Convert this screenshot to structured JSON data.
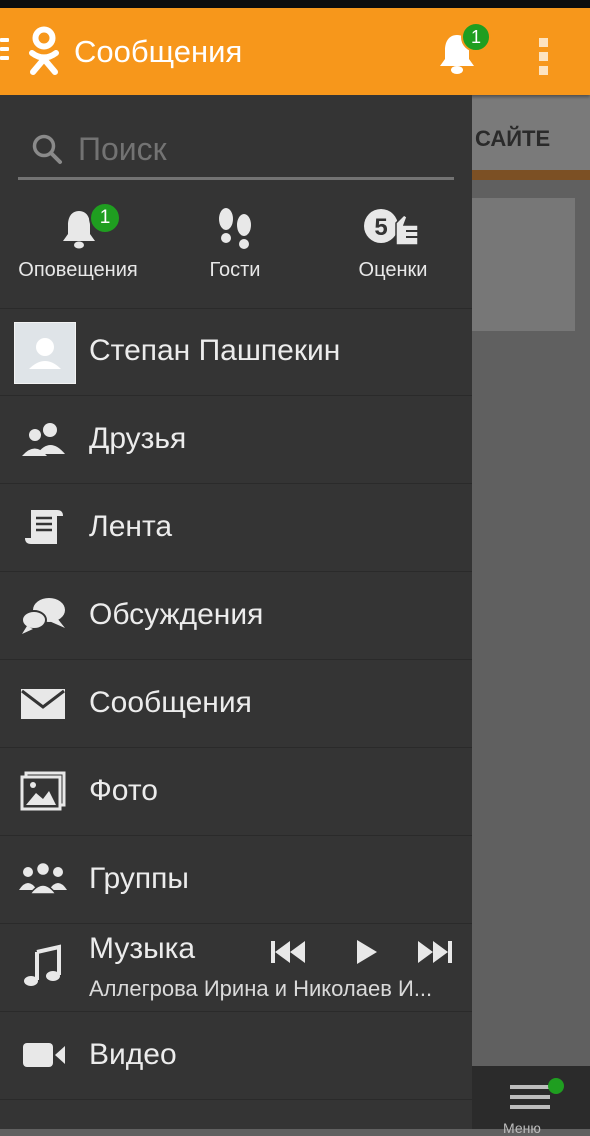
{
  "app_bar": {
    "title": "Сообщения",
    "notification_count": "1",
    "colors": {
      "bar": "#f7971b",
      "badge": "#1f9e20"
    }
  },
  "background": {
    "tab_label": "САЙТЕ",
    "bottom_nav_label": "Меню"
  },
  "drawer": {
    "search": {
      "placeholder": "Поиск"
    },
    "quick_actions": [
      {
        "label": "Оповещения",
        "icon": "bell-icon",
        "badge": "1"
      },
      {
        "label": "Гости",
        "icon": "footprints-icon"
      },
      {
        "label": "Оценки",
        "icon": "rating-five-icon"
      }
    ],
    "profile": {
      "name": "Степан Пашпекин"
    },
    "menu": [
      {
        "label": "Друзья",
        "icon": "friends-icon"
      },
      {
        "label": "Лента",
        "icon": "feed-icon"
      },
      {
        "label": "Обсуждения",
        "icon": "discussions-icon"
      },
      {
        "label": "Сообщения",
        "icon": "envelope-icon"
      },
      {
        "label": "Фото",
        "icon": "photo-icon"
      },
      {
        "label": "Группы",
        "icon": "groups-icon"
      }
    ],
    "music": {
      "label": "Музыка",
      "now_playing": "Аллегрова Ирина и Николаев И..."
    },
    "video": {
      "label": "Видео",
      "icon": "video-camera-icon"
    }
  }
}
